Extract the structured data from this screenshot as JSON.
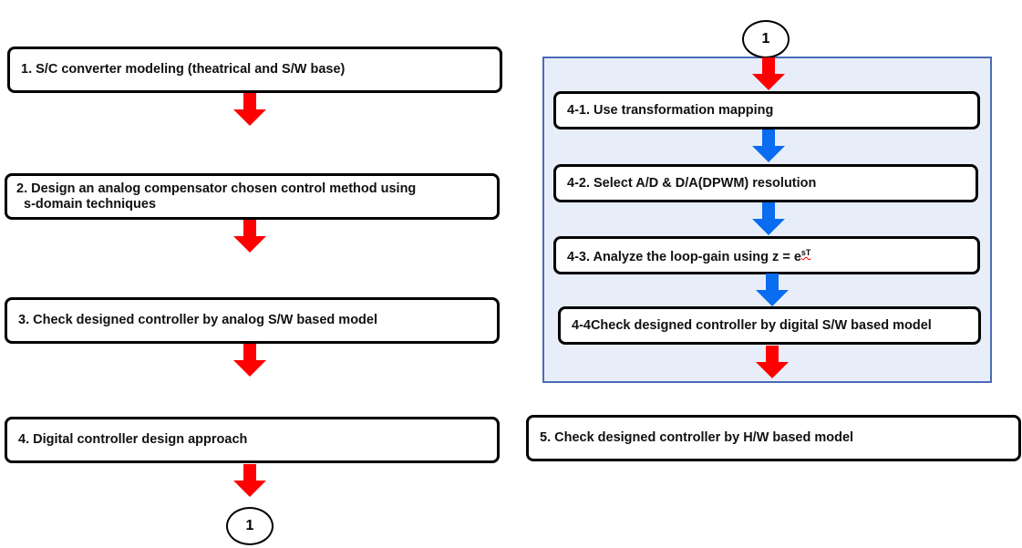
{
  "left_steps": [
    {
      "label": "1. S/C converter modeling (theatrical and S/W base)"
    },
    {
      "label": "2. Design an analog compensator chosen control method using",
      "label2": "s-domain techniques"
    },
    {
      "label": "3. Check designed controller by analog S/W based model"
    },
    {
      "label": "4. Digital controller design approach"
    }
  ],
  "connector_label": "1",
  "sub_steps": [
    {
      "label": "4-1. Use transformation mapping"
    },
    {
      "label": "4-2. Select A/D & D/A(DPWM) resolution"
    },
    {
      "label": "4-3. Analyze the loop-gain using z = e",
      "sup": "sT"
    },
    {
      "label": "4-4Check designed controller by digital S/W based model"
    }
  ],
  "final_step": {
    "label": "5. Check designed controller by H/W based model"
  },
  "colors": {
    "red_arrow": "#ff0000",
    "blue_arrow": "#0a6cf0",
    "panel_fill": "#e8eef9",
    "panel_border": "#4a6bb5"
  }
}
